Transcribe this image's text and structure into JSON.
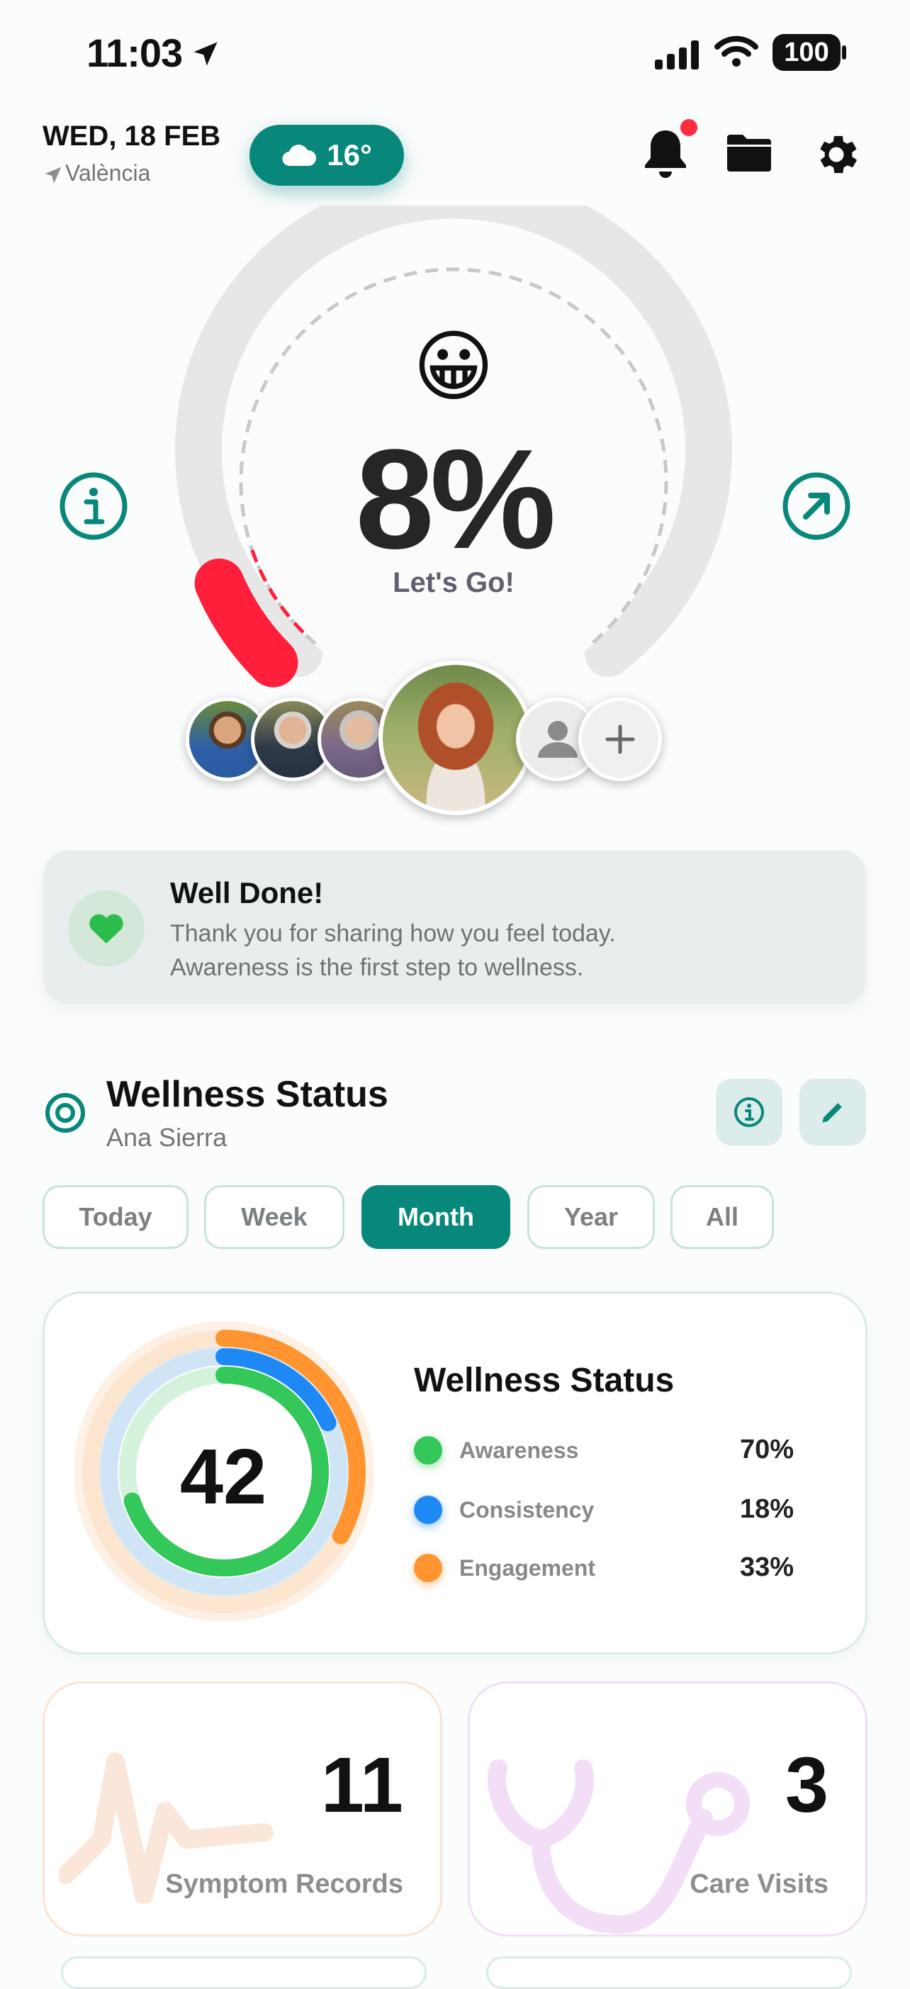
{
  "status_bar": {
    "time": "11:03",
    "battery": "100"
  },
  "header": {
    "date": "WED, 18 FEB",
    "location": "València",
    "weather_temp": "16°"
  },
  "gauge": {
    "emoji": "😀",
    "percent_label": "8%",
    "progress": 0.08,
    "message": "Let's Go!"
  },
  "well_done": {
    "title": "Well Done!",
    "line1": "Thank you for sharing how you feel today.",
    "line2": "Awareness is the first step to wellness."
  },
  "wellness_section": {
    "title": "Wellness Status",
    "user": "Ana Sierra"
  },
  "period_tabs": [
    {
      "label": "Today",
      "active": false
    },
    {
      "label": "Week",
      "active": false
    },
    {
      "label": "Month",
      "active": true
    },
    {
      "label": "Year",
      "active": false
    },
    {
      "label": "All",
      "active": false
    }
  ],
  "status_card": {
    "score": "42",
    "title": "Wellness Status",
    "metrics": [
      {
        "name": "Awareness",
        "value": "70%",
        "fraction": 0.7,
        "color": "#34c759"
      },
      {
        "name": "Consistency",
        "value": "18%",
        "fraction": 0.18,
        "color": "#1e88f5"
      },
      {
        "name": "Engagement",
        "value": "33%",
        "fraction": 0.33,
        "color": "#ff9430"
      }
    ]
  },
  "stats": [
    {
      "value": "11",
      "label": "Symptom Records",
      "icon": "heartbeat-icon"
    },
    {
      "value": "3",
      "label": "Care Visits",
      "icon": "stethoscope-icon"
    }
  ],
  "colors": {
    "accent": "#07887a",
    "danger": "#ff1f3a"
  }
}
